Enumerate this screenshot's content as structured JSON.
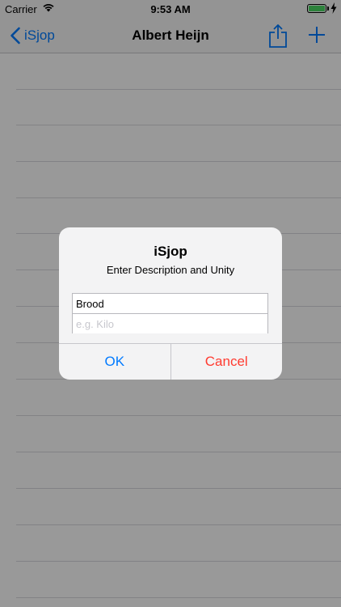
{
  "status_bar": {
    "carrier": "Carrier",
    "time": "9:53 AM",
    "battery_level": 1.0,
    "battery_color": "#4cd964",
    "icons": [
      "wifi-icon",
      "battery-icon",
      "charging-bolt-icon"
    ]
  },
  "nav": {
    "back_label": "iSjop",
    "title": "Albert Heijn",
    "icons": [
      "chevron-left-icon",
      "share-icon",
      "plus-icon"
    ],
    "accent_color": "#007aff"
  },
  "alert": {
    "title": "iSjop",
    "message": "Enter Description and Unity",
    "description_value": "Brood",
    "unit_placeholder": "e.g. Kilo",
    "ok_label": "OK",
    "cancel_label": "Cancel",
    "cancel_color": "#ff3b30"
  }
}
